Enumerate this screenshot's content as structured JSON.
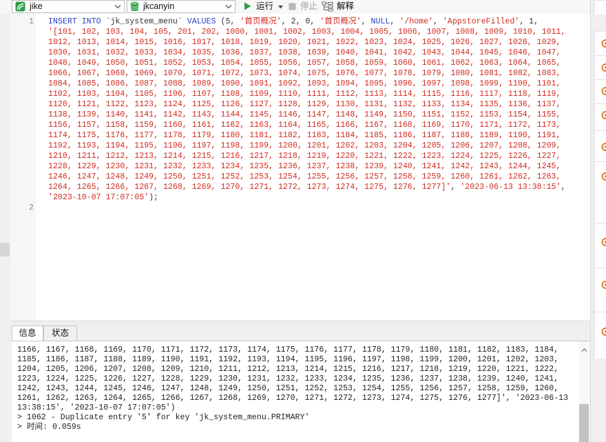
{
  "toolbar": {
    "connection": {
      "label": "jike",
      "icon": "connection-icon"
    },
    "database": {
      "label": "jkcanyin",
      "icon": "database-icon"
    },
    "run": {
      "label": "运行",
      "icon": "play-icon"
    },
    "stop": {
      "label": "停止",
      "icon": "stop-icon"
    },
    "explain": {
      "label": "解释",
      "icon": "explain-icon"
    }
  },
  "editor": {
    "lines": [
      {
        "number": "1",
        "rows": [
          "INSERT INTO `jk_system_menu` VALUES (5, '首页概况', 2, 0, '首页概况', NULL, '/home', 'AppstoreFilled', 1,",
          "'[101, 102, 103, 104, 105, 201, 202, 1000, 1001, 1002, 1003, 1004, 1005, 1006, 1007, 1008, 1009, 1010, 1011,",
          "1012, 1013, 1014, 1015, 1016, 1017, 1018, 1019, 1020, 1021, 1022, 1023, 1024, 1025, 1026, 1027, 1028, 1029,",
          "1030, 1031, 1032, 1033, 1034, 1035, 1036, 1037, 1038, 1039, 1040, 1041, 1042, 1043, 1044, 1045, 1046, 1047,",
          "1048, 1049, 1050, 1051, 1052, 1053, 1054, 1055, 1056, 1057, 1058, 1059, 1060, 1061, 1062, 1063, 1064, 1065,",
          "1066, 1067, 1068, 1069, 1070, 1071, 1072, 1073, 1074, 1075, 1076, 1077, 1078, 1079, 1080, 1081, 1082, 1083,",
          "1084, 1085, 1086, 1087, 1088, 1089, 1090, 1091, 1092, 1093, 1094, 1095, 1096, 1097, 1098, 1099, 1100, 1101,",
          "1102, 1103, 1104, 1105, 1106, 1107, 1108, 1109, 1110, 1111, 1112, 1113, 1114, 1115, 1116, 1117, 1118, 1119,",
          "1120, 1121, 1122, 1123, 1124, 1125, 1126, 1127, 1128, 1129, 1130, 1131, 1132, 1133, 1134, 1135, 1136, 1137,",
          "1138, 1139, 1140, 1141, 1142, 1143, 1144, 1145, 1146, 1147, 1148, 1149, 1150, 1151, 1152, 1153, 1154, 1155,",
          "1156, 1157, 1158, 1159, 1160, 1161, 1162, 1163, 1164, 1165, 1166, 1167, 1168, 1169, 1170, 1171, 1172, 1173,",
          "1174, 1175, 1176, 1177, 1178, 1179, 1180, 1181, 1182, 1183, 1184, 1185, 1186, 1187, 1188, 1189, 1190, 1191,",
          "1192, 1193, 1194, 1195, 1196, 1197, 1198, 1199, 1200, 1201, 1202, 1203, 1204, 1205, 1206, 1207, 1208, 1209,",
          "1210, 1211, 1212, 1213, 1214, 1215, 1216, 1217, 1218, 1219, 1220, 1221, 1222, 1223, 1224, 1225, 1226, 1227,",
          "1228, 1229, 1230, 1231, 1232, 1233, 1234, 1235, 1236, 1237, 1238, 1239, 1240, 1241, 1242, 1243, 1244, 1245,",
          "1246, 1247, 1248, 1249, 1250, 1251, 1252, 1253, 1254, 1255, 1256, 1257, 1258, 1259, 1260, 1261, 1262, 1263,",
          "1264, 1265, 1266, 1267, 1268, 1269, 1270, 1271, 1272, 1273, 1274, 1275, 1276, 1277]', '2023-06-13 13:38:15',",
          "'2023-10-07 17:07:05');"
        ]
      },
      {
        "number": "2",
        "rows": [
          ""
        ]
      }
    ]
  },
  "bottom_panel": {
    "tabs": [
      {
        "label": "信息",
        "active": true
      },
      {
        "label": "状态",
        "active": false
      }
    ],
    "message_lines": [
      "1166, 1167, 1168, 1169, 1170, 1171, 1172, 1173, 1174, 1175, 1176, 1177, 1178, 1179, 1180, 1181, 1182, 1183, 1184,",
      "1185, 1186, 1187, 1188, 1189, 1190, 1191, 1192, 1193, 1194, 1195, 1196, 1197, 1198, 1199, 1200, 1201, 1202, 1203,",
      "1204, 1205, 1206, 1207, 1208, 1209, 1210, 1211, 1212, 1213, 1214, 1215, 1216, 1217, 1218, 1219, 1220, 1221, 1222,",
      "1223, 1224, 1225, 1226, 1227, 1228, 1229, 1230, 1231, 1232, 1233, 1234, 1235, 1236, 1237, 1238, 1239, 1240, 1241,",
      "1242, 1243, 1244, 1245, 1246, 1247, 1248, 1249, 1250, 1251, 1252, 1253, 1254, 1255, 1256, 1257, 1258, 1259, 1260,",
      "1261, 1262, 1263, 1264, 1265, 1266, 1267, 1268, 1269, 1270, 1271, 1272, 1273, 1274, 1275, 1276, 1277]', '2023-06-13",
      "13:38:15', '2023-10-07 17:07:05')",
      "> 1062 - Duplicate entry '5' for key 'jk_system_menu.PRIMARY'",
      "> 时间: 0.059s"
    ]
  },
  "right_panel": {
    "item_icon": "status-ring-icon"
  },
  "colors": {
    "keyword": "#2b3fc4",
    "string": "#d12a1f",
    "text": "#333333",
    "brand_green": "#2e9d48",
    "item_icon": "#e07b2a"
  }
}
